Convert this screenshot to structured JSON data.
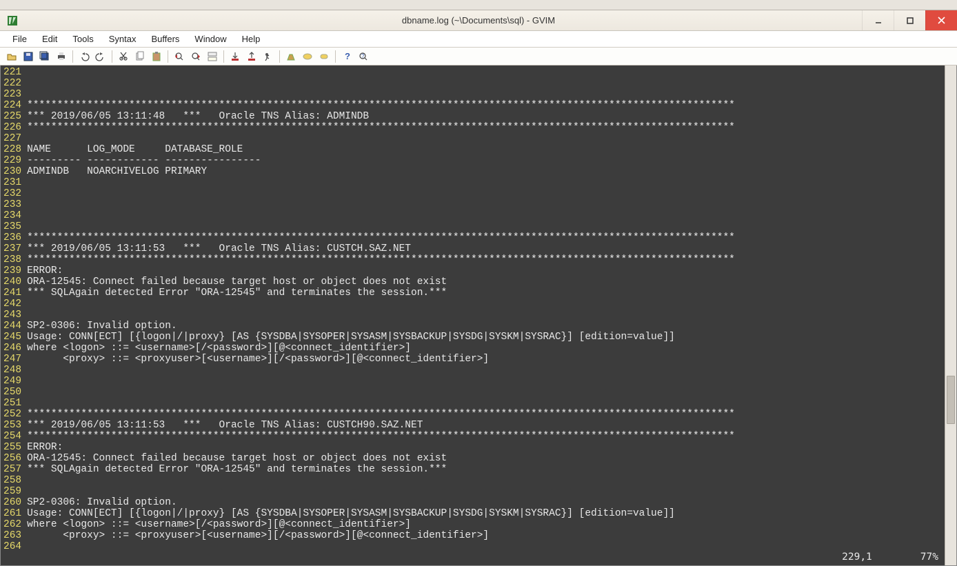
{
  "tab_remnant": "",
  "window": {
    "title": "dbname.log (~\\Documents\\sql) - GVIM"
  },
  "menu": {
    "items": [
      "File",
      "Edit",
      "Tools",
      "Syntax",
      "Buffers",
      "Window",
      "Help"
    ]
  },
  "toolbar": {
    "icons": [
      "open-icon",
      "save-icon",
      "save-all-icon",
      "print-icon",
      "sep",
      "undo-icon",
      "redo-icon",
      "sep",
      "cut-icon",
      "copy-icon",
      "paste-icon",
      "sep",
      "find-prev-icon",
      "find-next-icon",
      "replace-icon",
      "sep",
      "load-session-icon",
      "save-session-icon",
      "run-script-icon",
      "sep",
      "make-icon",
      "shell-icon",
      "tag-icon",
      "sep",
      "help-icon",
      "find-help-icon"
    ]
  },
  "editor": {
    "first_line_number": 221,
    "lines": [
      "",
      "",
      "",
      "**********************************************************************************************************************",
      "*** 2019/06/05 13:11:48   ***   Oracle TNS Alias: ADMINDB",
      "**********************************************************************************************************************",
      "",
      "NAME      LOG_MODE     DATABASE_ROLE",
      "--------- ------------ ----------------",
      "ADMINDB   NOARCHIVELOG PRIMARY",
      "",
      "",
      "",
      "",
      "",
      "**********************************************************************************************************************",
      "*** 2019/06/05 13:11:53   ***   Oracle TNS Alias: CUSTCH.SAZ.NET",
      "**********************************************************************************************************************",
      "ERROR:",
      "ORA-12545: Connect failed because target host or object does not exist",
      "*** SQLAgain detected Error \"ORA-12545\" and terminates the session.***",
      "",
      "",
      "SP2-0306: Invalid option.",
      "Usage: CONN[ECT] [{logon|/|proxy} [AS {SYSDBA|SYSOPER|SYSASM|SYSBACKUP|SYSDG|SYSKM|SYSRAC}] [edition=value]]",
      "where <logon> ::= <username>[/<password>][@<connect_identifier>]",
      "      <proxy> ::= <proxyuser>[<username>][/<password>][@<connect_identifier>]",
      "",
      "",
      "",
      "",
      "**********************************************************************************************************************",
      "*** 2019/06/05 13:11:53   ***   Oracle TNS Alias: CUSTCH90.SAZ.NET",
      "**********************************************************************************************************************",
      "ERROR:",
      "ORA-12545: Connect failed because target host or object does not exist",
      "*** SQLAgain detected Error \"ORA-12545\" and terminates the session.***",
      "",
      "",
      "SP2-0306: Invalid option.",
      "Usage: CONN[ECT] [{logon|/|proxy} [AS {SYSDBA|SYSOPER|SYSASM|SYSBACKUP|SYSDG|SYSKM|SYSRAC}] [edition=value]]",
      "where <logon> ::= <username>[/<password>][@<connect_identifier>]",
      "      <proxy> ::= <proxyuser>[<username>][/<password>][@<connect_identifier>]",
      ""
    ]
  },
  "status": {
    "position": "229,1",
    "percent": "77%"
  }
}
